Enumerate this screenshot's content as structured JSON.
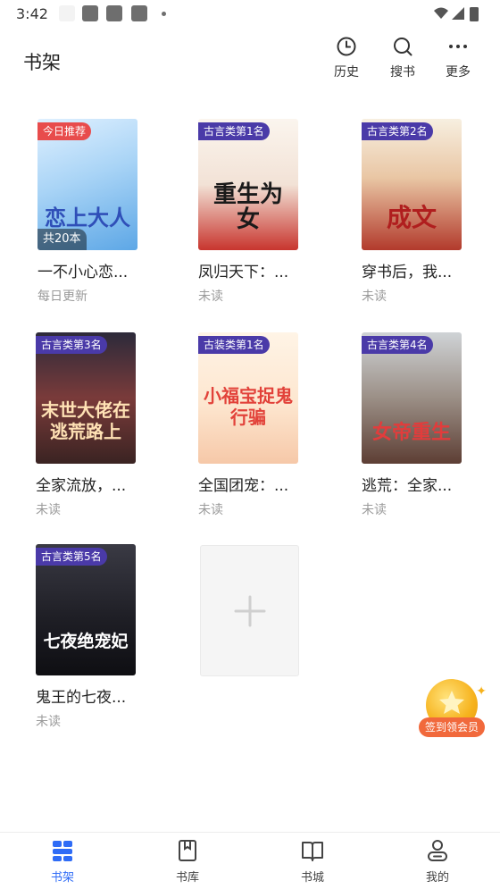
{
  "status_bar": {
    "time": "3:42"
  },
  "header": {
    "title": "书架",
    "actions": [
      {
        "label": "历史",
        "icon": "history-clock-icon"
      },
      {
        "label": "搜书",
        "icon": "search-icon"
      },
      {
        "label": "更多",
        "icon": "more-dots-icon"
      }
    ]
  },
  "books": [
    {
      "tag": "今日推荐",
      "count": "共20本",
      "cover_text": "恋上大人",
      "title": "一不小心恋...",
      "status": "每日更新"
    },
    {
      "tag": "古言类第1名",
      "cover_text": "重生为女",
      "title": "凤归天下：...",
      "status": "未读"
    },
    {
      "tag": "古言类第2名",
      "cover_text": "成文",
      "title": "穿书后，我...",
      "status": "未读"
    },
    {
      "tag": "古言类第3名",
      "cover_text": "末世大佬在逃荒路上",
      "title": "全家流放，...",
      "status": "未读"
    },
    {
      "tag": "古装类第1名",
      "cover_text": "小福宝捉鬼行骗",
      "title": "全国团宠：...",
      "status": "未读"
    },
    {
      "tag": "古言类第4名",
      "cover_text": "女帝重生",
      "title": "逃荒：全家...",
      "status": "未读"
    },
    {
      "tag": "古言类第5名",
      "cover_text": "七夜绝宠妃",
      "title": "鬼王的七夜...",
      "status": "未读"
    }
  ],
  "float_badge": {
    "label": "签到领会员"
  },
  "bottom_nav": [
    {
      "label": "书架",
      "icon": "bookshelf-icon",
      "active": true
    },
    {
      "label": "书库",
      "icon": "library-icon"
    },
    {
      "label": "书城",
      "icon": "bookstore-icon"
    },
    {
      "label": "我的",
      "icon": "profile-icon"
    }
  ],
  "colors": {
    "accent": "#2f6cf6",
    "rank_badge": "#4a3aa8",
    "today_badge": "#e84c4c",
    "badge_pill": "#f1693c"
  }
}
